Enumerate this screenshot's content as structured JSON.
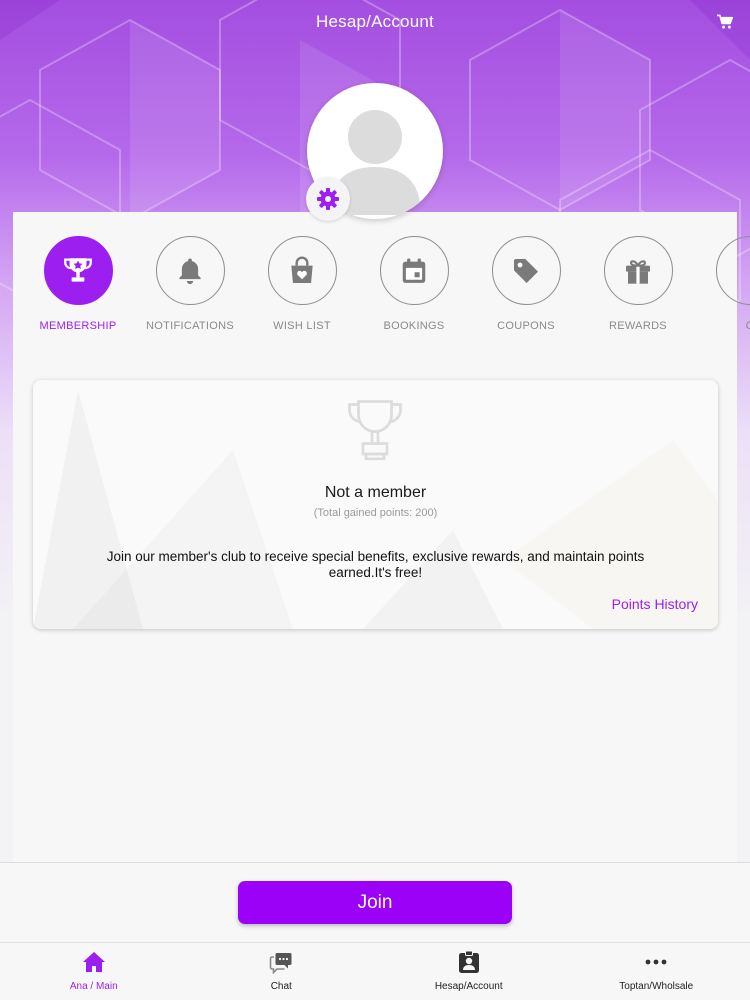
{
  "header": {
    "title": "Hesap/Account",
    "cart_icon": "shopping-cart-icon"
  },
  "profile": {
    "avatar_icon": "user-placeholder-icon",
    "settings_icon": "gear-icon"
  },
  "categories": [
    {
      "label": "MEMBERSHIP",
      "icon": "trophy-icon",
      "active": true
    },
    {
      "label": "NOTIFICATIONS",
      "icon": "bell-icon",
      "active": false
    },
    {
      "label": "WISH LIST",
      "icon": "shopping-bag-heart-icon",
      "active": false
    },
    {
      "label": "BOOKINGS",
      "icon": "calendar-icon",
      "active": false
    },
    {
      "label": "COUPONS",
      "icon": "tag-icon",
      "active": false
    },
    {
      "label": "REWARDS",
      "icon": "gift-icon",
      "active": false
    },
    {
      "label": "O",
      "icon": "partial-icon",
      "active": false
    }
  ],
  "membership": {
    "title": "Not a member",
    "subtitle": "(Total gained points: 200)",
    "description": "Join our member's club to receive special benefits, exclusive rewards, and maintain points earned.It's free!",
    "points_history_label": "Points History"
  },
  "join": {
    "label": "Join"
  },
  "bottom_nav": [
    {
      "label": "Ana / Main",
      "icon": "home-icon",
      "active": true
    },
    {
      "label": "Chat",
      "icon": "chat-icon",
      "active": false
    },
    {
      "label": "Hesap/Account",
      "icon": "account-badge-icon",
      "active": false
    },
    {
      "label": "Toptan/Wholsale",
      "icon": "more-icon",
      "active": false
    }
  ],
  "colors": {
    "accent": "#9C1FF0",
    "button": "#9B00F7",
    "inactive_icon": "#7A7A7A"
  }
}
